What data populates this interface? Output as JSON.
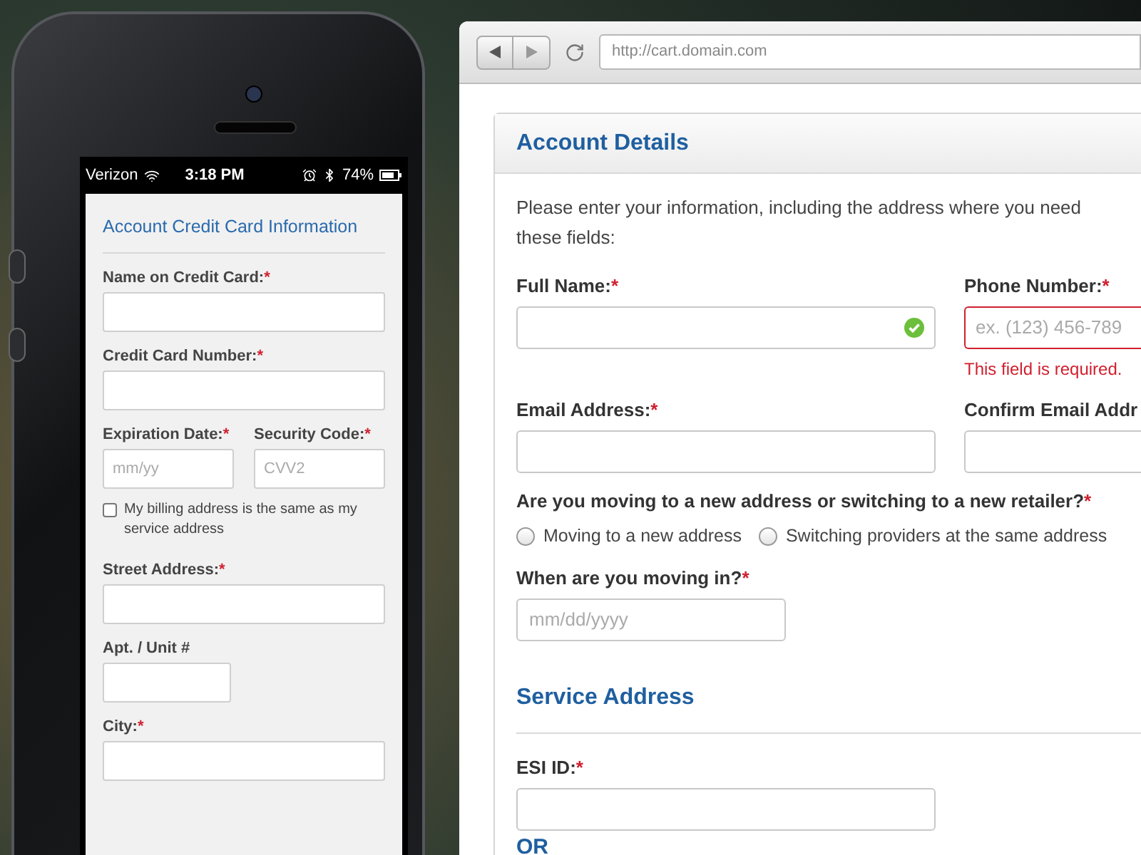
{
  "phone": {
    "status_bar": {
      "carrier": "Verizon",
      "time": "3:18 PM",
      "battery": "74%"
    },
    "form": {
      "title": "Account Credit Card Information",
      "fields": [
        {
          "kind": "text",
          "label": "Name on Credit Card:",
          "mark": "*"
        },
        {
          "kind": "text",
          "label": "Credit Card Number:",
          "mark": "*"
        },
        {
          "kind": "pair",
          "fields": [
            {
              "label": "Expiration Date:",
              "mark": "*",
              "placeholder": "mm/yy"
            },
            {
              "label": "Security Code:",
              "mark": "*",
              "placeholder": "CVV2"
            }
          ]
        },
        {
          "kind": "checkbox",
          "label": "My billing address is the same as my service address",
          "checked": false
        },
        {
          "kind": "text",
          "label": "Street Address:",
          "mark": "*"
        },
        {
          "kind": "short",
          "label": "Apt. / Unit #"
        },
        {
          "kind": "text",
          "label": "City:",
          "mark": "*"
        }
      ]
    }
  },
  "browser": {
    "url": "http://cart.domain.com",
    "panel": {
      "title": "Account Details",
      "intro_lines": [
        "Please enter your information, including the address where you need",
        "these fields:"
      ],
      "rows": [
        [
          {
            "label": "Full Name:",
            "mark": "*",
            "valid": true,
            "invalid": false
          },
          {
            "label": "Phone Number:",
            "mark": "*",
            "placeholder": "ex. (123) 456-789",
            "valid": false,
            "invalid": true,
            "error": "This field is required."
          }
        ],
        [
          {
            "label": "Email Address:",
            "mark": "*",
            "valid": false,
            "invalid": false
          },
          {
            "label": "Confirm Email Addr",
            "valid": false,
            "invalid": false
          }
        ]
      ],
      "question": {
        "label": "Are you moving to a new address or switching to a new retailer?",
        "mark": "*",
        "options": [
          {
            "label": "Moving to a new address",
            "selected": false
          },
          {
            "label": "Switching providers at the same address",
            "selected": false
          }
        ]
      },
      "move_date": {
        "label": "When are you moving in?",
        "mark": "*",
        "placeholder": "mm/dd/yyyy"
      },
      "section_title": "Service Address",
      "esi": {
        "label": "ESI ID:",
        "mark": "*"
      },
      "or_heading": "OR"
    }
  }
}
